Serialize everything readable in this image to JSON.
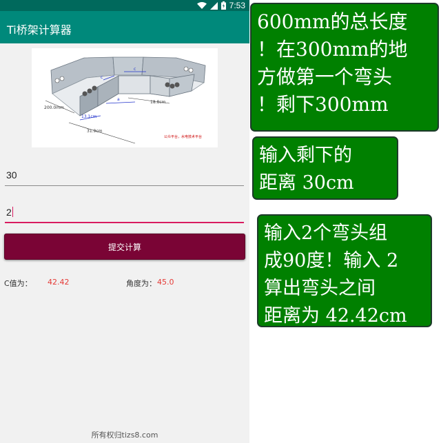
{
  "status_bar": {
    "time": "7:53"
  },
  "app_bar": {
    "title": "Ti桥架计算器"
  },
  "diagram": {
    "dim_200": "200.0mm",
    "dim_131": "13.1cm",
    "dim_319": "31.9cm",
    "dim_188": "18.8cm",
    "label_c_left": "c",
    "label_c_top": "c",
    "label_a": "a",
    "watermark": "公众平台，水电技术平台"
  },
  "form": {
    "distance_value": "30",
    "elbow_count_value": "2",
    "submit_label": "提交计算"
  },
  "result": {
    "c_label": "C值为：",
    "c_value": "42.42",
    "angle_label": "角度为：",
    "angle_value": "45.0"
  },
  "footer": {
    "text": "所有权归tizs8.com"
  },
  "notes": {
    "note1": [
      "600mm的总长度",
      "！在300mm的地",
      "方做第一个弯头",
      "！剩下300mm"
    ],
    "note2": [
      "输入剩下的",
      "距离 30cm"
    ],
    "note3": [
      "输入2个弯头组",
      "成90度！输入 2",
      "算出弯头之间",
      "距离为 42.42cm"
    ]
  },
  "colors": {
    "status_bar": "#00695c",
    "app_bar": "#00897b",
    "submit_button": "#7a0435",
    "accent": "#d81b60",
    "result_value": "#e53935",
    "note_bg": "#008000"
  }
}
